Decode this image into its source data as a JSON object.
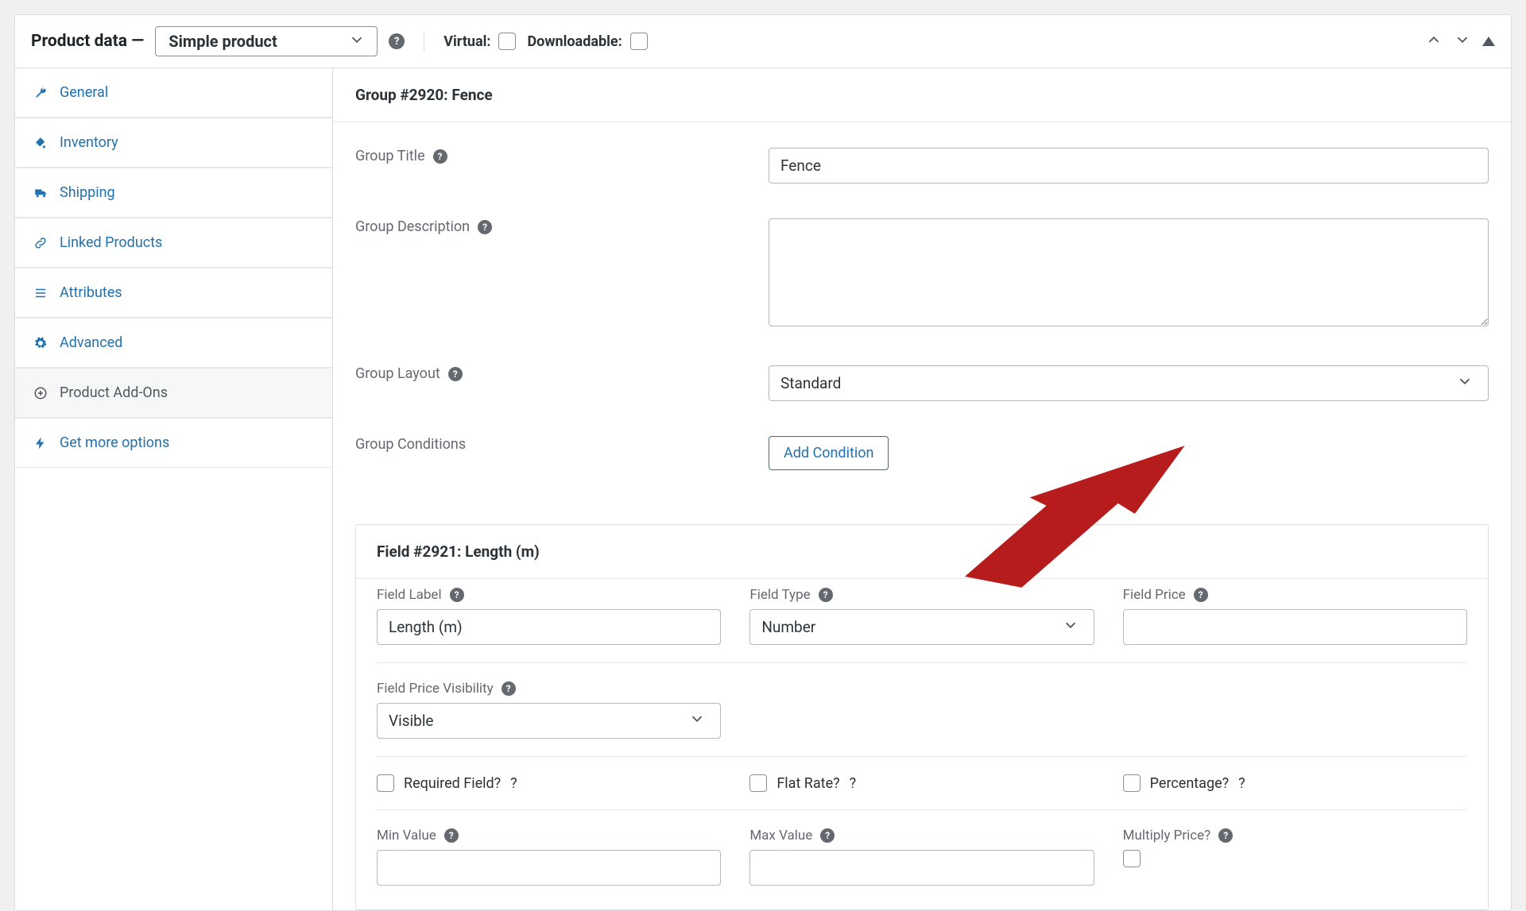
{
  "header": {
    "title": "Product data",
    "dash": "—",
    "product_type": "Simple product",
    "virtual_label": "Virtual:",
    "downloadable_label": "Downloadable:"
  },
  "tabs": [
    {
      "key": "general",
      "label": "General",
      "icon": "wrench"
    },
    {
      "key": "inventory",
      "label": "Inventory",
      "icon": "fill"
    },
    {
      "key": "shipping",
      "label": "Shipping",
      "icon": "truck"
    },
    {
      "key": "linked",
      "label": "Linked Products",
      "icon": "link"
    },
    {
      "key": "attributes",
      "label": "Attributes",
      "icon": "list"
    },
    {
      "key": "advanced",
      "label": "Advanced",
      "icon": "gear"
    },
    {
      "key": "addons",
      "label": "Product Add-Ons",
      "icon": "plus"
    },
    {
      "key": "more",
      "label": "Get more options",
      "icon": "bolt"
    }
  ],
  "group": {
    "heading": "Group #2920: Fence",
    "labels": {
      "title": "Group Title",
      "description": "Group Description",
      "layout": "Group Layout",
      "conditions": "Group Conditions"
    },
    "values": {
      "title": "Fence",
      "description": "",
      "layout": "Standard"
    },
    "add_condition": "Add Condition"
  },
  "field": {
    "heading": "Field #2921: Length (m)",
    "labels": {
      "field_label": "Field Label",
      "field_type": "Field Type",
      "field_price": "Field Price",
      "price_visibility": "Field Price Visibility",
      "required": "Required Field?",
      "flat_rate": "Flat Rate?",
      "percentage": "Percentage?",
      "min_value": "Min Value",
      "max_value": "Max Value",
      "multiply": "Multiply Price?"
    },
    "values": {
      "field_label": "Length (m)",
      "field_type": "Number",
      "field_price": "",
      "price_visibility": "Visible",
      "min_value": "",
      "max_value": ""
    }
  }
}
